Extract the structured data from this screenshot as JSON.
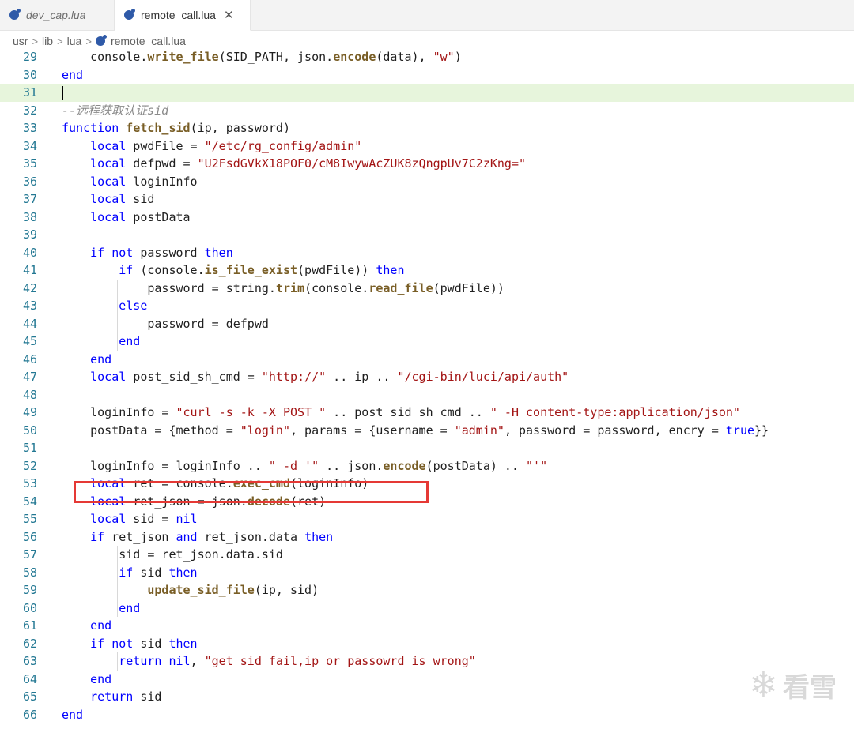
{
  "tabs": [
    {
      "label": "dev_cap.lua",
      "active": false
    },
    {
      "label": "remote_call.lua",
      "active": true
    }
  ],
  "breadcrumb": [
    "usr",
    "lib",
    "lua",
    "remote_call.lua"
  ],
  "lines": [
    {
      "n": "29",
      "text": "    console.write_file(SID_PATH, json.encode(data), \"w\")"
    },
    {
      "n": "30",
      "text": "end"
    },
    {
      "n": "31",
      "text": ""
    },
    {
      "n": "32",
      "text": "--远程获取认证sid"
    },
    {
      "n": "33",
      "text": "function fetch_sid(ip, password)"
    },
    {
      "n": "34",
      "text": "    local pwdFile = \"/etc/rg_config/admin\""
    },
    {
      "n": "35",
      "text": "    local defpwd = \"U2FsdGVkX18POF0/cM8IwywAcZUK8zQngpUv7C2zKng=\""
    },
    {
      "n": "36",
      "text": "    local loginInfo"
    },
    {
      "n": "37",
      "text": "    local sid"
    },
    {
      "n": "38",
      "text": "    local postData"
    },
    {
      "n": "39",
      "text": ""
    },
    {
      "n": "40",
      "text": "    if not password then"
    },
    {
      "n": "41",
      "text": "        if (console.is_file_exist(pwdFile)) then"
    },
    {
      "n": "42",
      "text": "            password = string.trim(console.read_file(pwdFile))"
    },
    {
      "n": "43",
      "text": "        else"
    },
    {
      "n": "44",
      "text": "            password = defpwd"
    },
    {
      "n": "45",
      "text": "        end"
    },
    {
      "n": "46",
      "text": "    end"
    },
    {
      "n": "47",
      "text": "    local post_sid_sh_cmd = \"http://\" .. ip .. \"/cgi-bin/luci/api/auth\""
    },
    {
      "n": "48",
      "text": ""
    },
    {
      "n": "49",
      "text": "    loginInfo = \"curl -s -k -X POST \" .. post_sid_sh_cmd .. \" -H content-type:application/json\""
    },
    {
      "n": "50",
      "text": "    postData = {method = \"login\", params = {username = \"admin\", password = password, encry = true}}"
    },
    {
      "n": "51",
      "text": ""
    },
    {
      "n": "52",
      "text": "    loginInfo = loginInfo .. \" -d '\" .. json.encode(postData) .. \"'\""
    },
    {
      "n": "53",
      "text": "    local ret = console.exec_cmd(loginInfo)"
    },
    {
      "n": "54",
      "text": "    local ret_json = json.decode(ret)"
    },
    {
      "n": "55",
      "text": "    local sid = nil"
    },
    {
      "n": "56",
      "text": "    if ret_json and ret_json.data then"
    },
    {
      "n": "57",
      "text": "        sid = ret_json.data.sid"
    },
    {
      "n": "58",
      "text": "        if sid then"
    },
    {
      "n": "59",
      "text": "            update_sid_file(ip, sid)"
    },
    {
      "n": "60",
      "text": "        end"
    },
    {
      "n": "61",
      "text": "    end"
    },
    {
      "n": "62",
      "text": "    if not sid then"
    },
    {
      "n": "63",
      "text": "        return nil, \"get sid fail,ip or passowrd is wrong\""
    },
    {
      "n": "64",
      "text": "    end"
    },
    {
      "n": "65",
      "text": "    return sid"
    },
    {
      "n": "66",
      "text": "end"
    }
  ],
  "watermark": "看雪",
  "colors": {
    "highlight_box": "#e53935",
    "current_line": "#e7f5dc"
  }
}
